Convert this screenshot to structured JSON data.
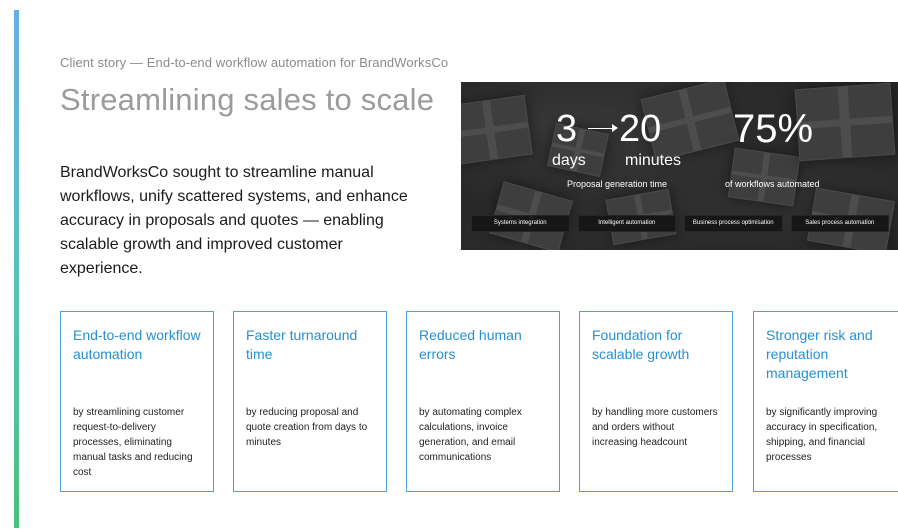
{
  "eyebrow": "Client story — End-to-end workflow automation for BrandWorksCo",
  "title": "Streamlining sales to scale",
  "intro": "BrandWorksCo sought to streamline manual workflows, unify scattered systems, and enhance accuracy in proposals and quotes — enabling scalable growth and improved customer experience.",
  "hero": {
    "from_value": "3",
    "to_value": "20",
    "from_unit": "days",
    "to_unit": "minutes",
    "caption_left": "Proposal generation time",
    "percent": "75%",
    "caption_right": "of workflows automated",
    "tags": [
      "Systems integration",
      "Intelligent automation",
      "Business process optimisation",
      "Sales process automation"
    ]
  },
  "cards": [
    {
      "title": "End-to-end workflow automation",
      "body": "by streamlining customer request-to-delivery processes, eliminating manual tasks and reducing cost"
    },
    {
      "title": "Faster turnaround time",
      "body": "by reducing proposal and quote creation from days to minutes"
    },
    {
      "title": "Reduced human errors",
      "body": "by automating complex calculations, invoice generation, and email communications"
    },
    {
      "title": "Foundation for scalable growth",
      "body": "by handling more customers and orders without increasing headcount"
    },
    {
      "title": "Stronger risk and reputation management",
      "body": "by significantly improving accuracy in specification, shipping, and financial processes"
    }
  ],
  "colors": {
    "accent_blue": "#2790d0",
    "card_border": "#4fa1d8",
    "bar_top": "#62b0e6",
    "bar_bottom": "#47c27a"
  }
}
